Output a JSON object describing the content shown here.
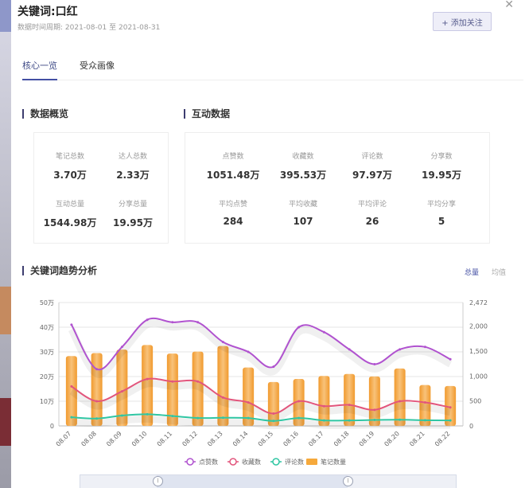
{
  "header": {
    "title": "关键词:口红",
    "date_label": "数据时间周期:",
    "date_start": "2021-08-01",
    "date_sep": "至",
    "date_end": "2021-08-31",
    "follow_label": "+ 添加关注",
    "close_icon": "close-icon"
  },
  "tabs": [
    {
      "label": "核心一览",
      "active": true
    },
    {
      "label": "受众画像",
      "active": false
    }
  ],
  "overview": {
    "title": "数据概览",
    "stats": [
      {
        "label": "笔记总数",
        "value": "3.70万"
      },
      {
        "label": "达人总数",
        "value": "2.33万"
      },
      {
        "label": "互动总量",
        "value": "1544.98万"
      },
      {
        "label": "分享总量",
        "value": "19.95万"
      }
    ]
  },
  "interaction": {
    "title": "互动数据",
    "stats": [
      {
        "label": "点赞数",
        "value": "1051.48万"
      },
      {
        "label": "收藏数",
        "value": "395.53万"
      },
      {
        "label": "评论数",
        "value": "97.97万"
      },
      {
        "label": "分享数",
        "value": "19.95万"
      },
      {
        "label": "平均点赞",
        "value": "284"
      },
      {
        "label": "平均收藏",
        "value": "107"
      },
      {
        "label": "平均评论",
        "value": "26"
      },
      {
        "label": "平均分享",
        "value": "5"
      }
    ]
  },
  "trend": {
    "title": "关键词趋势分析",
    "toggle_total": "总量",
    "toggle_avg": "均值"
  },
  "colors": {
    "accent": "#434fa3",
    "likes": "#b052cf",
    "favorites": "#e2557c",
    "comments": "#2fc6a3",
    "notes": "#f6a93b"
  },
  "chart_data": {
    "type": "bar",
    "categories": [
      "08.07",
      "08.08",
      "08.09",
      "08.10",
      "08.11",
      "08.12",
      "08.13",
      "08.14",
      "08.15",
      "08.16",
      "08.17",
      "08.18",
      "08.19",
      "08.20",
      "08.21",
      "08.22"
    ],
    "y_left": {
      "ticks": [
        "0",
        "10万",
        "20万",
        "30万",
        "40万",
        "50万"
      ],
      "range": [
        0,
        500000
      ]
    },
    "y_right": {
      "ticks": [
        "0",
        "500",
        "1,000",
        "1,500",
        "2,000",
        "2,472"
      ],
      "range": [
        0,
        2472
      ]
    },
    "series": [
      {
        "name": "点赞数",
        "type": "line",
        "axis": "left",
        "values": [
          410000,
          230000,
          320000,
          430000,
          420000,
          420000,
          340000,
          300000,
          240000,
          400000,
          380000,
          310000,
          250000,
          310000,
          320000,
          270000
        ]
      },
      {
        "name": "收藏数",
        "type": "line",
        "axis": "left",
        "values": [
          160000,
          100000,
          140000,
          190000,
          180000,
          180000,
          115000,
          95000,
          50000,
          100000,
          80000,
          85000,
          65000,
          100000,
          95000,
          75000
        ]
      },
      {
        "name": "评论数",
        "type": "line",
        "axis": "left",
        "values": [
          35000,
          30000,
          42000,
          47000,
          40000,
          32000,
          33000,
          32000,
          20000,
          32000,
          22000,
          22000,
          24000,
          25000,
          23000,
          22000
        ]
      },
      {
        "name": "笔记数量",
        "type": "bar",
        "axis": "right",
        "values": [
          1400,
          1460,
          1530,
          1620,
          1450,
          1490,
          1600,
          1170,
          880,
          940,
          1000,
          1040,
          990,
          1150,
          820,
          800
        ]
      }
    ],
    "legend_position": "bottom",
    "grid": true
  }
}
